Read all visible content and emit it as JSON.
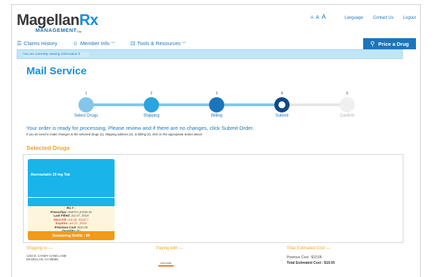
{
  "header": {
    "logo": {
      "brand": "Magellan",
      "rx": "Rx",
      "sub": "MANAGEMENT",
      "tm": "TM"
    },
    "text_size": [
      "A",
      "A",
      "A"
    ],
    "links": [
      "Language",
      "Contact Us",
      "Logout"
    ]
  },
  "nav": {
    "items": [
      {
        "label": "Claims History",
        "icon": "list-icon",
        "chevron": ""
      },
      {
        "label": "Member Info",
        "icon": "person-icon",
        "chevron": "﹀"
      },
      {
        "label": "Tools & Resources",
        "icon": "toolbox-icon",
        "chevron": "﹀"
      }
    ],
    "price_button": "Price a Drug"
  },
  "viewing_bar": "You are currently viewing information fr",
  "page_title": "Mail Service",
  "stepper": {
    "steps": [
      {
        "num": "1",
        "label": "Select Drugs",
        "color": "#84c6e9"
      },
      {
        "num": "2",
        "label": "Shipping",
        "color": "#2aa3e0"
      },
      {
        "num": "3",
        "label": "Billing",
        "color": "#1b75bb"
      },
      {
        "num": "4",
        "label": "Submit",
        "color": "#0f4a86"
      },
      {
        "num": "5",
        "label": "Confirm",
        "color": "#f0f0f0"
      }
    ]
  },
  "messages": {
    "ready": "Your order is ready for processing. Please review and if there are no changes, click Submit Order.",
    "hint": "If you do need to make changes to the selected drugs (1), shipping address (2), or billing (3), click on the appropriate button above."
  },
  "selected_drugs": {
    "title": "Selected Drugs",
    "drug": {
      "name": "Atorvastatin 20 mg Tab",
      "rx_label": "Rx # :",
      "rx_value": "",
      "prescriber_label": "Prescriber :",
      "prescriber_value": "SMITH,JOHN,W",
      "last_filled_label": "Last Filled :",
      "last_filled_value": "Jul 27, 2018",
      "next_fill_label": "Next Fill :",
      "next_fill_value": "Jul 29, 2018",
      "expires_label": "Expires :",
      "expires_value": "Jul 27, 2019",
      "prev_cost_label": "Previous Cost :",
      "prev_cost_value": "$10.05",
      "quantity_label": "Quantity :",
      "quantity_value": "90",
      "refills_label": "Remaining Refills : 99",
      "refills_remaining": 99
    }
  },
  "footer": {
    "shipping_title": "Shipping to —",
    "address_line1": "1234 E. CANDY CANE LANE",
    "address_line2": "MAGELLAN, CA 85665",
    "paying_title": "Paying with —",
    "card_brand": "DISCOVER",
    "total_title": "Total Estimated Cost —",
    "previous_cost": "Previous Cost : $10.05",
    "total_cost": "Total Estimated Cost : $10.05"
  }
}
